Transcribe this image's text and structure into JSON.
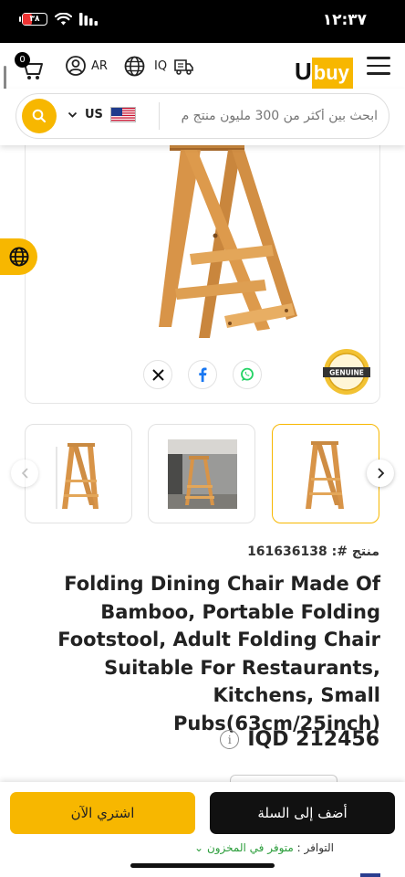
{
  "status_bar": {
    "time": "١٢:٣٧",
    "battery": "٣٨",
    "icons": [
      "battery-icon",
      "wifi-icon",
      "signal-icon"
    ]
  },
  "header": {
    "cart_count": "0",
    "language": "AR",
    "country": "IQ",
    "logo": {
      "first": "U",
      "second": "buy"
    },
    "icons": [
      "cart-icon",
      "user-icon",
      "globe-icon",
      "delivery-truck-icon",
      "menu-icon"
    ]
  },
  "search": {
    "region": "US",
    "placeholder": "ابحث بين أكثر من 300 مليون منتج م",
    "icons": [
      "search-icon",
      "chevron-down-icon",
      "us-flag-icon"
    ]
  },
  "share_icons": [
    "x-icon",
    "facebook-icon",
    "whatsapp-icon"
  ],
  "genuine_badge": "GENUINE",
  "product": {
    "sku_label": "منتج #:",
    "sku": "161636138",
    "title": "Folding Dining Chair Made Of Bamboo, Portable Folding Footstool, Adult Folding Chair Suitable For Restaurants, Kitchens, Small Pubs(63cm/25inch)",
    "price": "IQD 212456",
    "info_glyph": "i"
  },
  "actions": {
    "buy_now": "اشتري الآن",
    "add_to_cart": "أضف إلى السلة"
  },
  "availability": {
    "label": "التوافر :",
    "value": "متوفر في المخزون"
  },
  "colors": {
    "accent": "#f7b700",
    "dark": "#111111",
    "available": "#2a9d3a"
  }
}
